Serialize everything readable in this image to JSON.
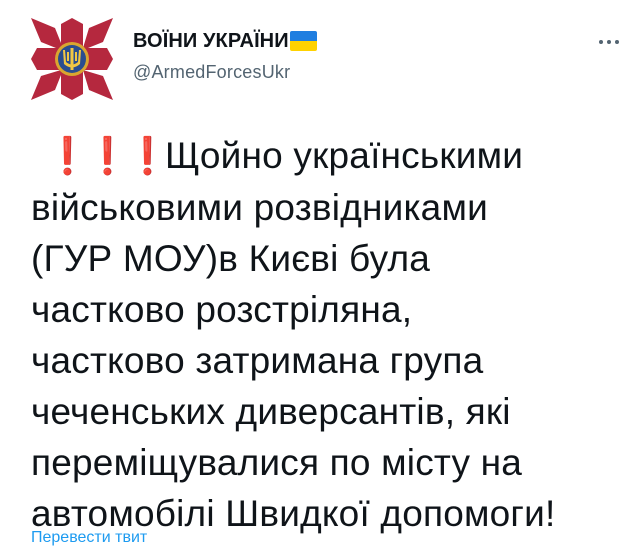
{
  "account": {
    "display_name": "ВОЇНИ УКРАЇНИ",
    "handle": "@ArmedForcesUkr",
    "verified_flag": {
      "top_color": "#1f7ee0",
      "bottom_color": "#ffd200"
    }
  },
  "avatar": {
    "cross_color": "#b5283e",
    "emblem_color": "#d9a630",
    "emblem_icon": "trident-icon"
  },
  "more_icon": "more-dots-icon",
  "tweet": {
    "emoji": "❗",
    "emoji_color": "#e0245e",
    "lines": [
      "Щойно українськими",
      "військовими розвідниками",
      "(ГУР МОУ)в Києві була",
      "частково розстріляна,",
      "частково затримана група",
      "чеченських диверсантів, які",
      "переміщувалися по місту на",
      "автомобілі Швидкої допомоги!"
    ]
  },
  "translate_link": "Перевести твит",
  "colors": {
    "text": "#0f1419",
    "secondary": "#536471",
    "link": "#1d9bf0"
  }
}
